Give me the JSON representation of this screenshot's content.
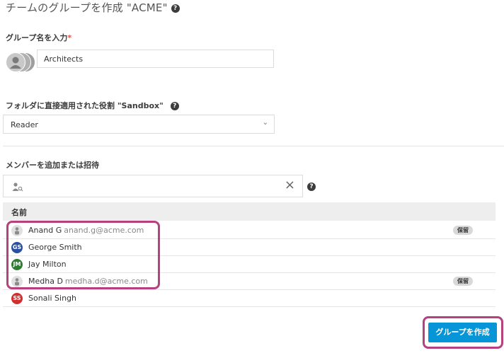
{
  "dialog": {
    "title": "チームのグループを作成 \"ACME\"",
    "help_glyph": "?"
  },
  "group_name": {
    "label": "グループ名を入力",
    "required_mark": "*",
    "value": "Architects"
  },
  "role": {
    "label": "フォルダに直接適用された役割 \"Sandbox\"",
    "selected": "Reader",
    "arrow": "⌄"
  },
  "members": {
    "label": "メンバーを追加または招待",
    "search_value": "",
    "clear_glyph": "×",
    "column_name": "名前",
    "rows": [
      {
        "initials": "",
        "name": "Anand G",
        "email": "anand.g@acme.com",
        "badge": "保留",
        "avatar_color": "#e0e0e0"
      },
      {
        "initials": "GS",
        "name": "George Smith",
        "email": "",
        "badge": "",
        "avatar_color": "#2b4fa0"
      },
      {
        "initials": "JM",
        "name": "Jay Milton",
        "email": "",
        "badge": "",
        "avatar_color": "#2e7d32"
      },
      {
        "initials": "",
        "name": "Medha D",
        "email": "medha.d@acme.com",
        "badge": "保留",
        "avatar_color": "#e0e0e0"
      },
      {
        "initials": "SS",
        "name": "Sonali Singh",
        "email": "",
        "badge": "",
        "avatar_color": "#d32f2f"
      }
    ]
  },
  "footer": {
    "create_button": "グループを作成"
  },
  "colors": {
    "accent": "#0696d7",
    "highlight": "#b5417f"
  }
}
